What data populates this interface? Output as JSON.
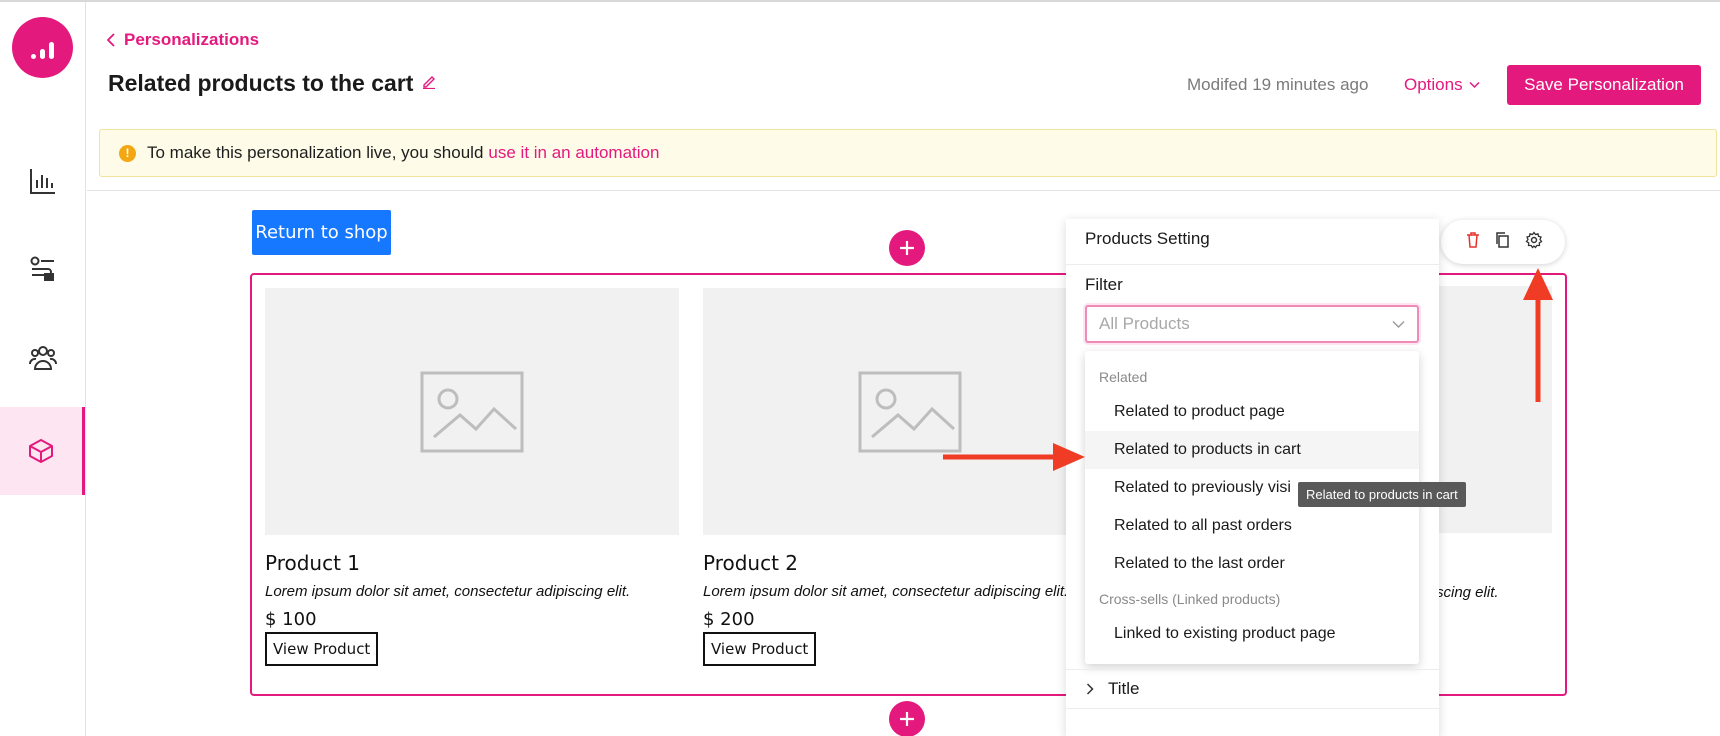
{
  "sidebar": {
    "items": [
      {
        "icon": "chart-bars-icon"
      },
      {
        "icon": "workflow-icon"
      },
      {
        "icon": "users-group-icon"
      },
      {
        "icon": "cube-icon",
        "active": true
      }
    ]
  },
  "header": {
    "back_label": "Personalizations",
    "title": "Related products to the cart",
    "modified": "Modifed 19 minutes ago",
    "options_label": "Options",
    "save_label": "Save Personalization"
  },
  "alert": {
    "icon": "!",
    "text": "To make this personalization live, you should",
    "link": "use it in an automation"
  },
  "canvas": {
    "return_label": "Return to shop",
    "products": [
      {
        "name": "Product 1",
        "desc": "Lorem ipsum dolor sit amet, consectetur adipiscing elit.",
        "price": "$ 100",
        "button": "View Product"
      },
      {
        "name": "Product 2",
        "desc": "Lorem ipsum dolor sit amet, consectetur adipiscing elit.",
        "price": "$ 200",
        "button": "View Product"
      }
    ],
    "product3_desc_fragment": "scing elit."
  },
  "panel": {
    "title": "Products Setting",
    "filter_label": "Filter",
    "filter_placeholder": "All Products",
    "dropdown": {
      "group1": "Related",
      "items1": [
        "Related to product page",
        "Related to products in cart",
        "Related to previously visi",
        "Related to all past orders",
        "Related to the last order"
      ],
      "group2": "Cross-sells (Linked products)",
      "items2": [
        "Linked to existing product page"
      ]
    },
    "title_section": "Title"
  },
  "tooltip": "Related to products in cart",
  "colors": {
    "brand": "#e4197e",
    "primary_blue": "#1677ff",
    "annotation_red": "#f03c24"
  }
}
